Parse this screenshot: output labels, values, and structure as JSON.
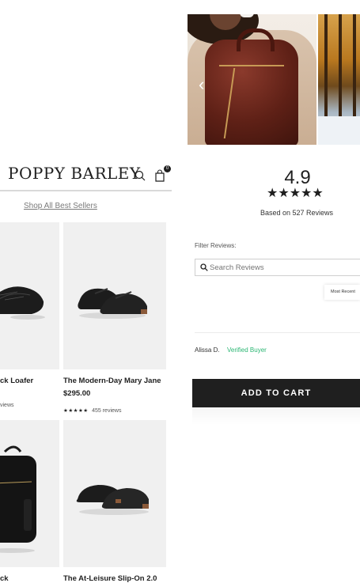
{
  "carousel": {
    "photos": [
      {
        "subject": "woman holding burgundy sequin backpack"
      },
      {
        "subject": "snowy autumn forest"
      }
    ],
    "prev_icon": "chevron-left-icon"
  },
  "store": {
    "brand": "POPPY BARLEY",
    "search_icon": "search-icon",
    "cart_icon": "shopping-bag-icon",
    "cart_count": "0",
    "shop_all_link": "Shop All Best Sellers"
  },
  "products": [
    {
      "title": "ck Loafer",
      "price": "",
      "stars": "",
      "reviews": "views"
    },
    {
      "title": "The Modern-Day Mary Jane",
      "price": "$295.00",
      "stars": "★★★★★",
      "reviews": "455 reviews"
    },
    {
      "title": "ck",
      "price": "",
      "stars": "",
      "reviews": ""
    },
    {
      "title": "The At-Leisure Slip-On 2.0",
      "price": "",
      "stars": "",
      "reviews": ""
    }
  ],
  "reviews": {
    "average": "4.9",
    "stars": "★★★★★",
    "based_on": "Based on 527 Reviews",
    "filter_label": "Filter Reviews:",
    "search_placeholder": "Search Reviews",
    "sort_label": "Most Recent",
    "reviewer_name": "Alissa D.",
    "verified_label": "Verified Buyer"
  },
  "cta": {
    "add_to_cart": "ADD TO CART"
  },
  "colors": {
    "text": "#1f1f1f",
    "verified": "#2bb673",
    "button_bg": "#1f1f1f",
    "tile_bg": "#f0f0f0"
  }
}
